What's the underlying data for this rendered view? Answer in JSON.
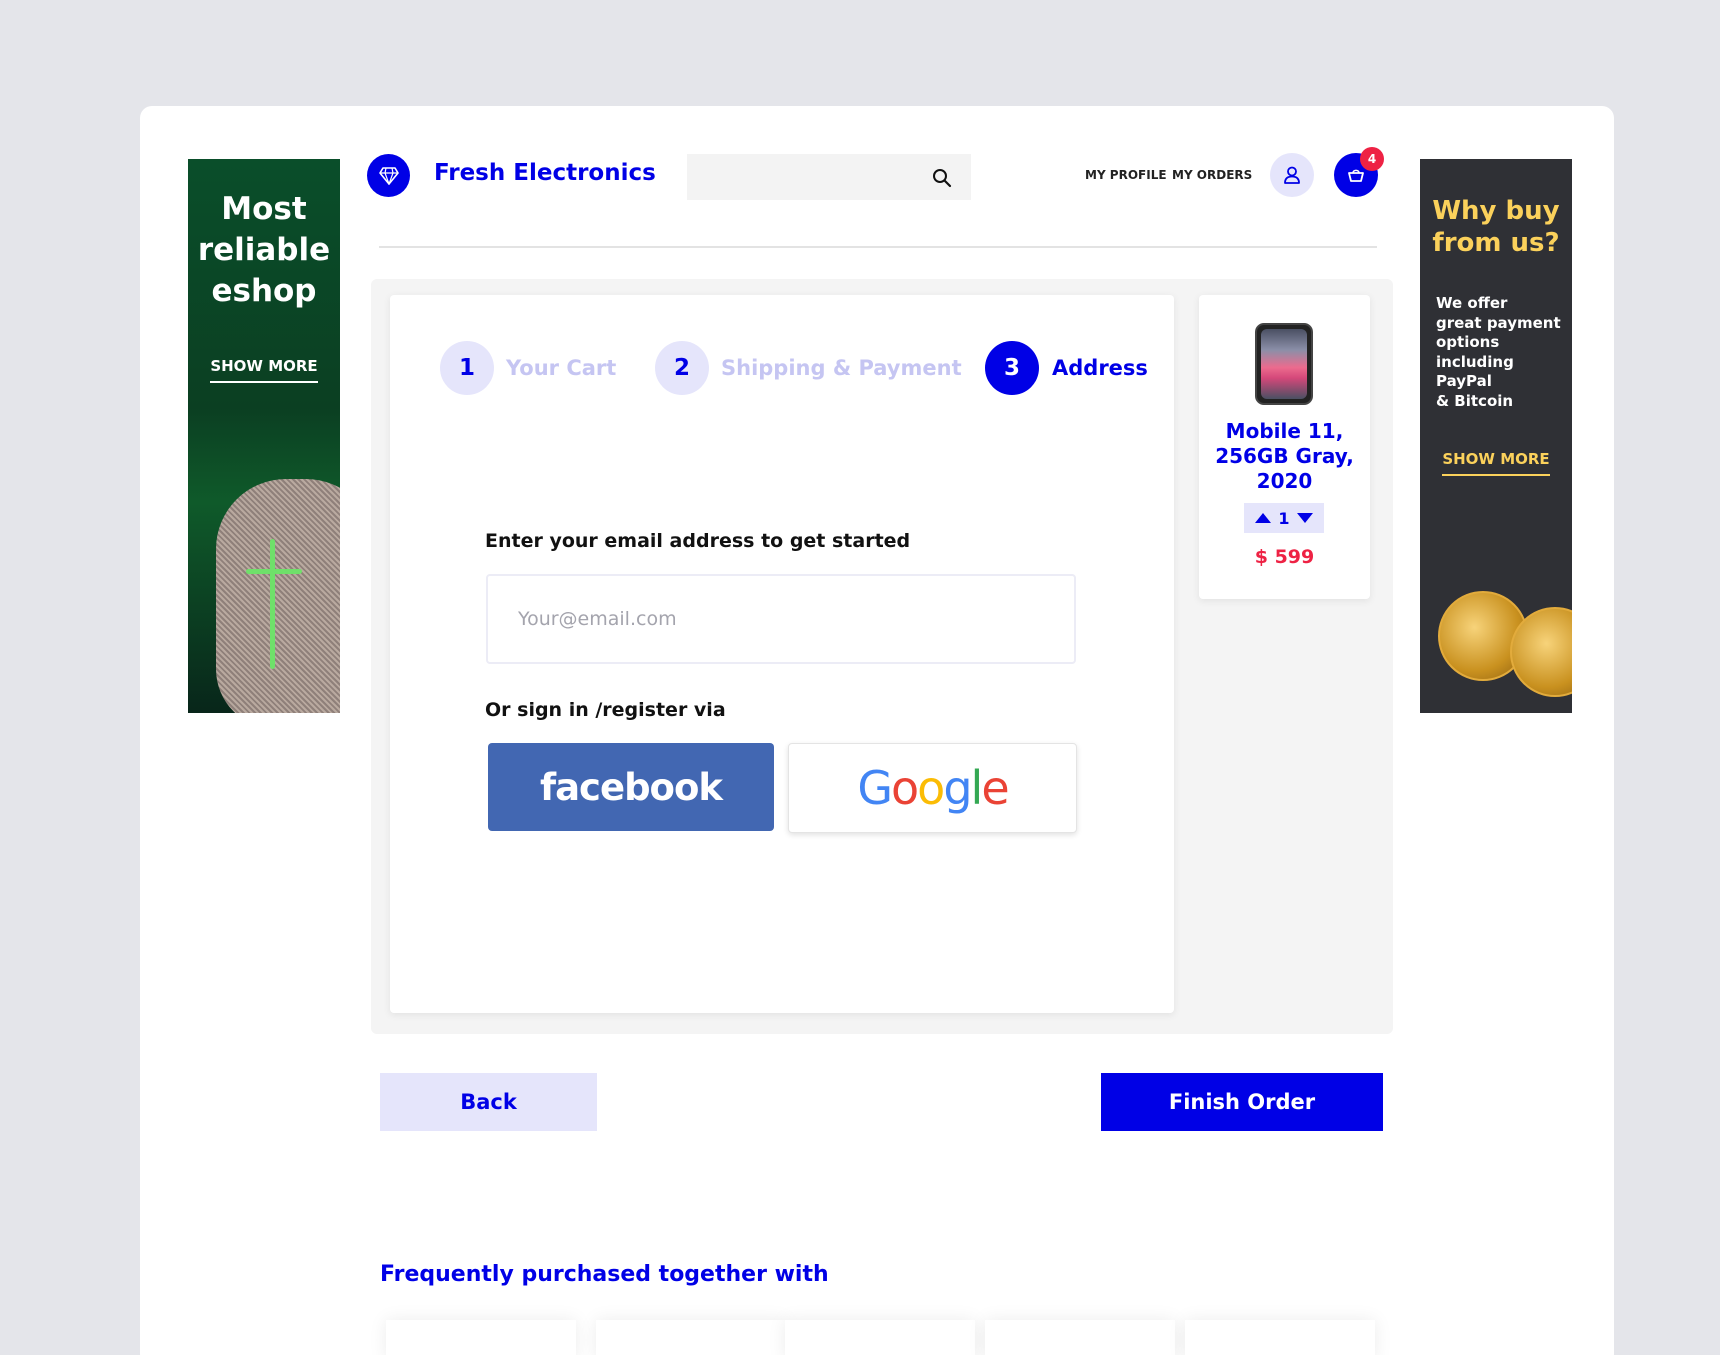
{
  "brand": {
    "name": "Fresh Electronics",
    "logo_icon": "diamond-icon"
  },
  "search": {
    "placeholder": "",
    "icon": "search-icon"
  },
  "nav": {
    "my_profile": "MY PROFILE",
    "my_orders": "MY ORDERS"
  },
  "cart": {
    "count": "4"
  },
  "ad_left": {
    "title_line1": "Most",
    "title_line2": "reliable",
    "title_line3": "eshop",
    "link": "SHOW MORE",
    "bg_color": "#0b3f22"
  },
  "ad_right": {
    "title_line1": "Why buy",
    "title_line2": "from us?",
    "text_lines": [
      "We offer",
      "great payment",
      "options",
      "including",
      "PayPal",
      "& Bitcoin"
    ],
    "link": "SHOW MORE",
    "accent": "#fbd15b"
  },
  "steps": [
    {
      "number": "1",
      "label": "Your Cart",
      "state": "inactive"
    },
    {
      "number": "2",
      "label": "Shipping & Payment",
      "state": "inactive"
    },
    {
      "number": "3",
      "label": "Address",
      "state": "active"
    }
  ],
  "form": {
    "email_label": "Enter your email address to get started",
    "email_placeholder": "Your@email.com",
    "email_value": "",
    "social_label": "Or sign in /register via",
    "facebook_label": "facebook",
    "google_label": "Google"
  },
  "product": {
    "name_line1": "Mobile 11,",
    "name_line2": "256GB Gray,",
    "name_line3": "2020",
    "quantity": "1",
    "price": "$ 599"
  },
  "actions": {
    "back": "Back",
    "finish": "Finish Order"
  },
  "related": {
    "title": "Frequently purchased together with"
  },
  "colors": {
    "accent": "#0000e6",
    "accent_light": "#e5e5fb",
    "price": "#ee2244",
    "facebook": "#4267b2"
  }
}
